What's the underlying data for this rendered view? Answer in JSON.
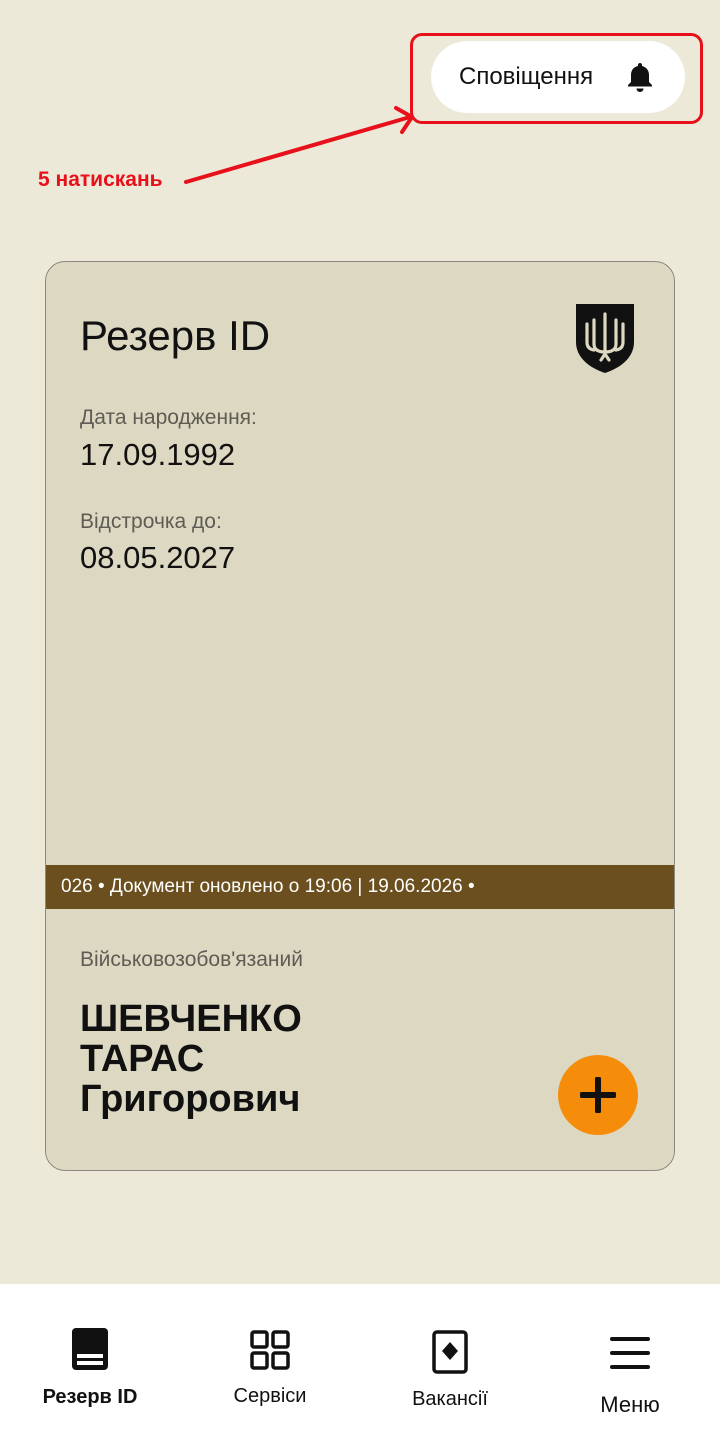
{
  "header": {
    "notifications_label": "Сповіщення",
    "notifications_icon": "bell-icon"
  },
  "annotation": {
    "label": "5 натискань",
    "color": "#e8101a"
  },
  "card": {
    "title": "Резерв ID",
    "emblem_icon": "trident-emblem-icon",
    "birth_label": "Дата народження:",
    "birth_value": "17.09.1992",
    "deferral_label": "Відстрочка до:",
    "deferral_value": "08.05.2027",
    "ticker_text": "026 • Документ оновлено о 19:06 | 19.06.2026 •",
    "status": "Військовозобов'язаний",
    "surname": "ШЕВЧЕНКО",
    "first_name": "ТАРАС",
    "patronymic": "Григорович",
    "add_icon": "plus-icon"
  },
  "nav": {
    "items": [
      {
        "label": "Резерв ID",
        "icon": "document-icon",
        "active": true
      },
      {
        "label": "Сервіси",
        "icon": "grid-icon",
        "active": false
      },
      {
        "label": "Вакансії",
        "icon": "vacancy-icon",
        "active": false
      },
      {
        "label": "Меню",
        "icon": "menu-icon",
        "active": false
      }
    ]
  },
  "colors": {
    "background": "#ece9d8",
    "card": "#ddd8c1",
    "ticker": "#6b4f1e",
    "accent": "#f58c0a"
  }
}
